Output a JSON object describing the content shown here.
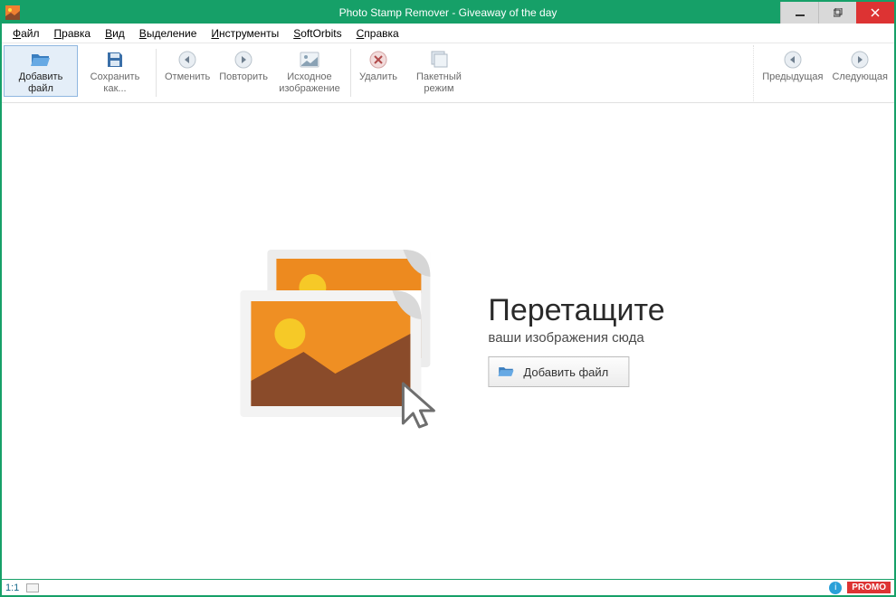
{
  "window": {
    "title": "Photo Stamp Remover - Giveaway of the day"
  },
  "menus": {
    "file": "Файл",
    "edit": "Правка",
    "view": "Вид",
    "sel": "Выделение",
    "tools": "Инструменты",
    "soft": "SoftOrbits",
    "help": "Справка"
  },
  "toolbar": {
    "add_file": "Добавить файл",
    "save_as": "Сохранить как...",
    "undo": "Отменить",
    "redo": "Повторить",
    "orig": "Исходное изображение",
    "delete": "Удалить",
    "batch": "Пакетный режим",
    "prev": "Предыдущая",
    "next": "Следующая"
  },
  "drop": {
    "title": "Перетащите",
    "sub": "ваши изображения сюда",
    "button": "Добавить файл"
  },
  "status": {
    "zoom": "1:1",
    "promo": "PROMO"
  },
  "colors": {
    "accent": "#16a068",
    "danger": "#d33"
  }
}
